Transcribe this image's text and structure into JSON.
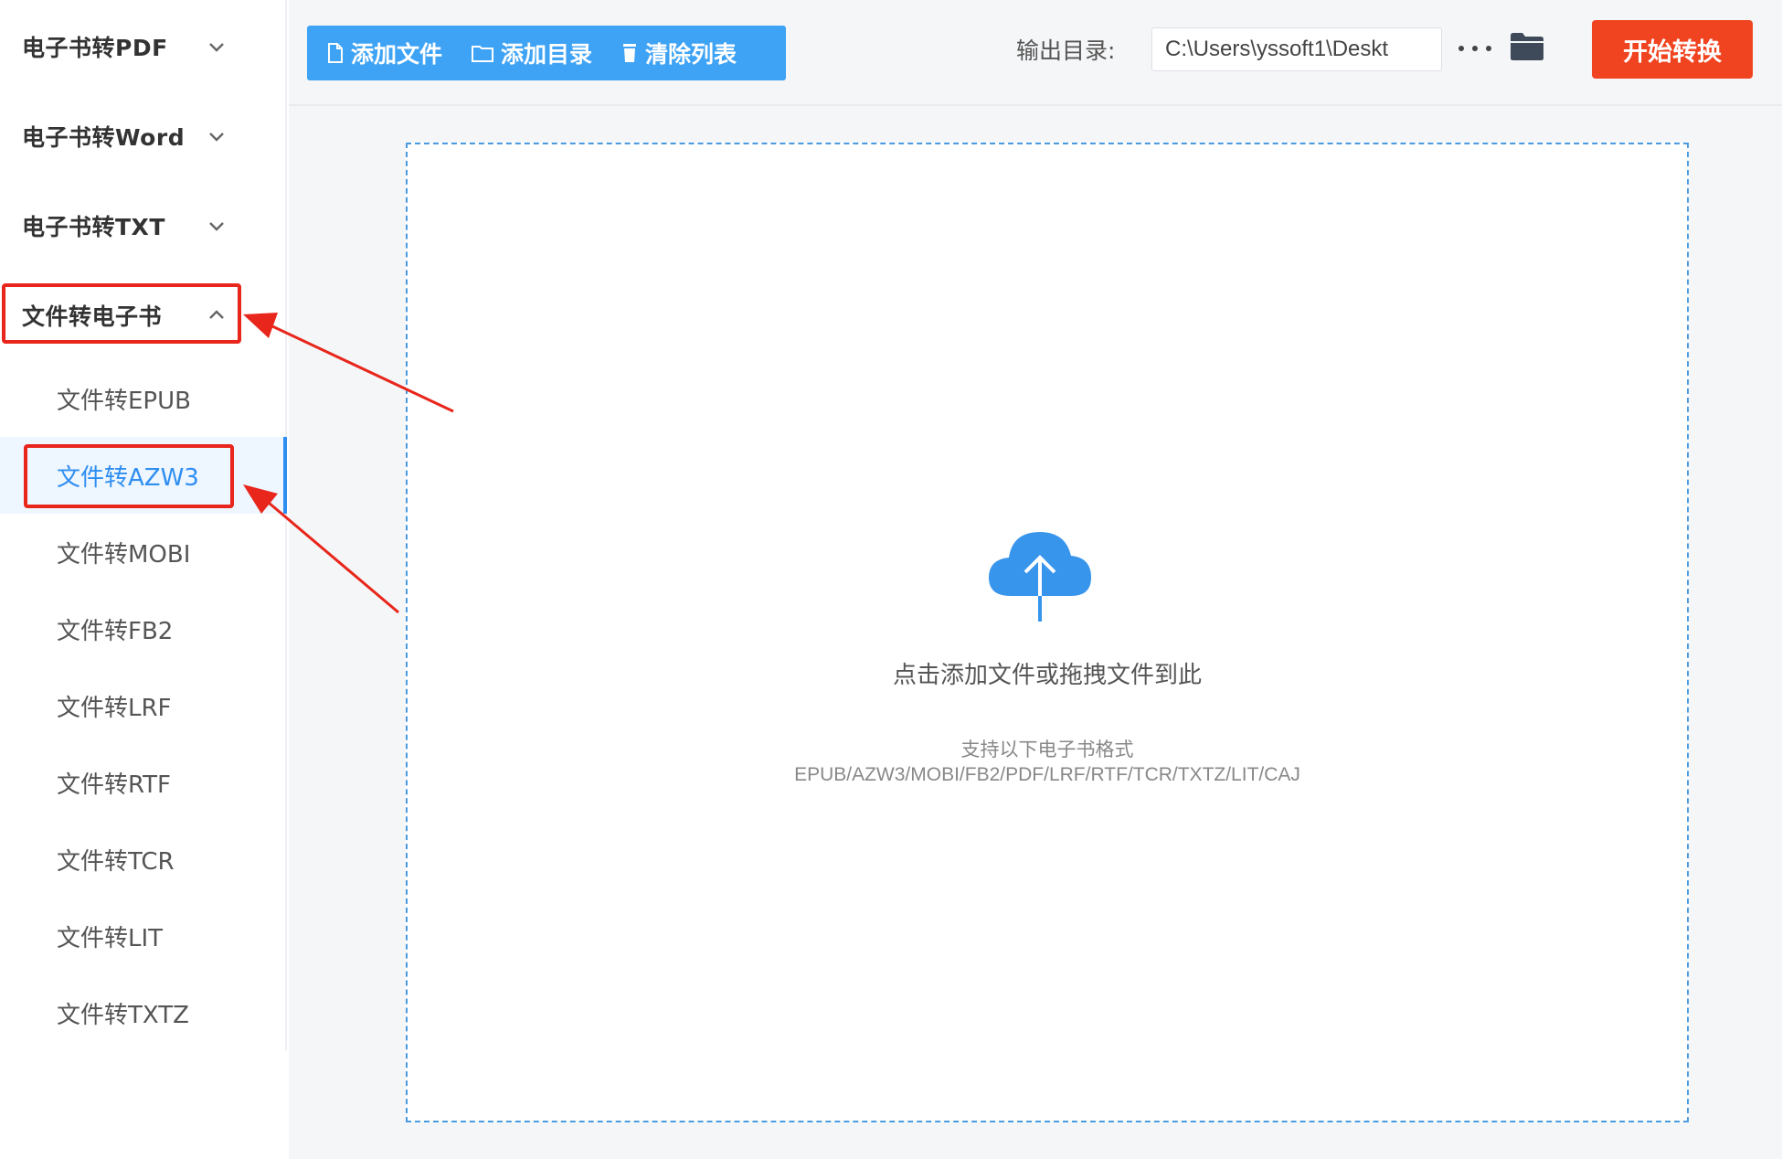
{
  "sidebar": {
    "groups": [
      {
        "label": "电子书转PDF"
      },
      {
        "label": "电子书转Word"
      },
      {
        "label": "电子书转TXT"
      },
      {
        "label": "文件转电子书"
      }
    ],
    "sub_items": [
      {
        "label": "文件转EPUB"
      },
      {
        "label": "文件转AZW3"
      },
      {
        "label": "文件转MOBI"
      },
      {
        "label": "文件转FB2"
      },
      {
        "label": "文件转LRF"
      },
      {
        "label": "文件转RTF"
      },
      {
        "label": "文件转TCR"
      },
      {
        "label": "文件转LIT"
      },
      {
        "label": "文件转TXTZ"
      }
    ],
    "active_item": "文件转AZW3"
  },
  "toolbar": {
    "add_file": "添加文件",
    "add_folder": "添加目录",
    "clear_list": "清除列表",
    "output_label": "输出目录:",
    "output_path": "C:\\Users\\yssoft1\\Deskt",
    "start_button": "开始转换"
  },
  "dropzone": {
    "title": "点击添加文件或拖拽文件到此",
    "subtitle": "支持以下电子书格式",
    "formats": "EPUB/AZW3/MOBI/FB2/PDF/LRF/RTF/TCR/TXTZ/LIT/CAJ"
  },
  "icons": {
    "chevron": "chevron-down-icon",
    "chevron_open": "chevron-up-icon",
    "file": "file-icon",
    "folder": "folder-icon",
    "trash": "trash-icon",
    "more": "more-dots-icon",
    "browse": "folder-open-icon",
    "upload": "cloud-upload-icon"
  },
  "colors": {
    "accent": "#3ea3f5",
    "active_text": "#2f8ef2",
    "start_button": "#f0431f",
    "annotation": "#e8261b"
  }
}
